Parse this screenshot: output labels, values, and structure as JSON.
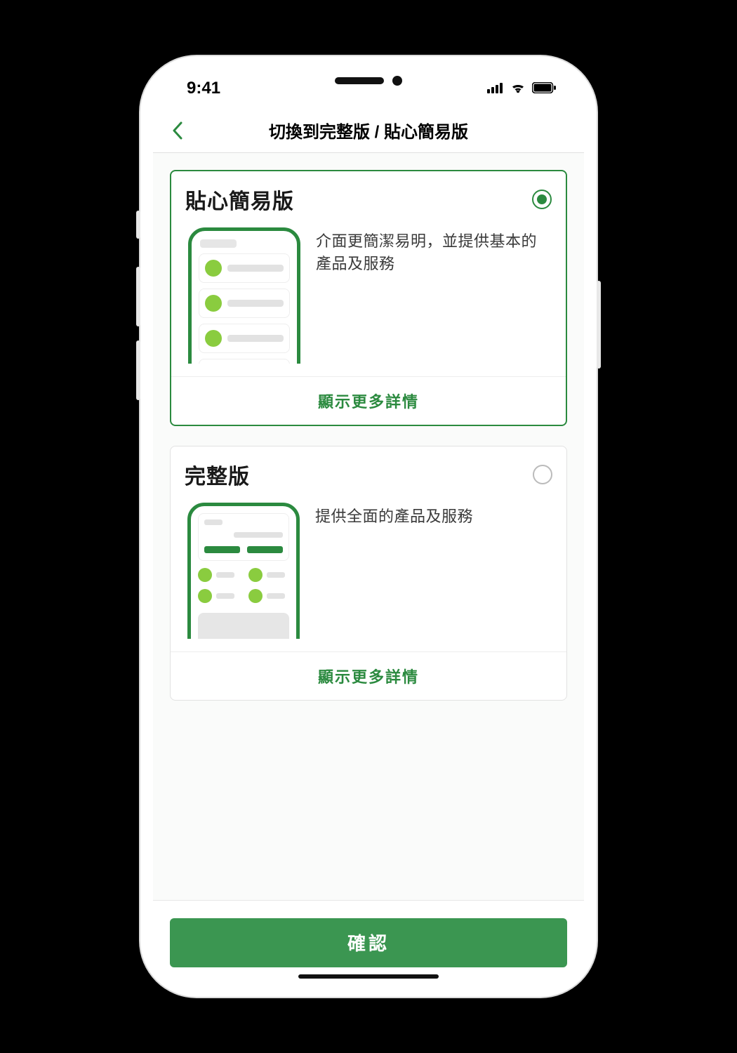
{
  "status": {
    "time": "9:41"
  },
  "header": {
    "title": "切換到完整版 / 貼心簡易版"
  },
  "options": [
    {
      "title": "貼心簡易版",
      "desc": "介面更簡潔易明，並提供基本的產品及服務",
      "more": "顯示更多詳情",
      "selected": true
    },
    {
      "title": "完整版",
      "desc": "提供全面的產品及服務",
      "more": "顯示更多詳情",
      "selected": false
    }
  ],
  "footer": {
    "confirm": "確認"
  }
}
